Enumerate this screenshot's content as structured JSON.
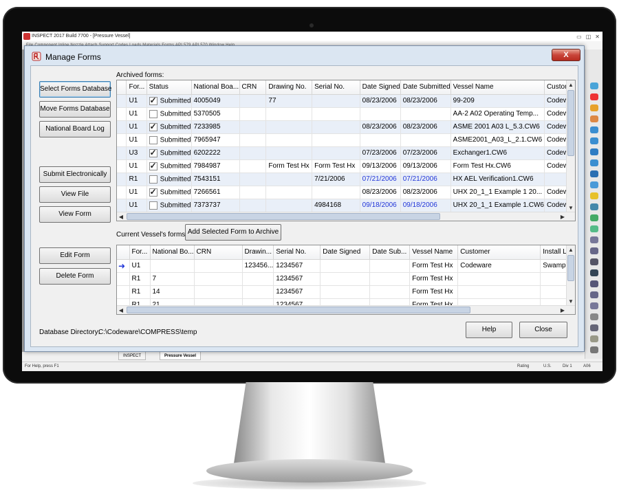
{
  "app": {
    "title": "INSPECT 2017 Build 7700 - [Pressure Vessel]",
    "menu": "File   Component   Inline   Nozzle   Attach   Support   Codes   Loads   Materials   Forms   API 579   API 570   Window   Help",
    "tabs": [
      "INSPECT",
      "Pressure Vessel"
    ],
    "status_left": "For Help, press F1",
    "status_cells": [
      "Rating",
      "U.S.",
      "Div 1",
      "A06"
    ]
  },
  "dialog": {
    "title": "Manage Forms",
    "close_label": "X",
    "archived_label": "Archived forms:",
    "current_label": "Current Vessel's forms:",
    "db_dir_label": "Database Directory:",
    "db_dir_value": "C:\\Codeware\\COMPRESS\\temp",
    "buttons": {
      "select_db": "Select Forms Database",
      "move_db": "Move Forms Database",
      "nb_log": "National Board Log",
      "submit": "Submit Electronically",
      "view_file": "View File",
      "view_form": "View Form",
      "edit_form": "Edit Form",
      "delete_form": "Delete Form",
      "add_to_archive": "Add Selected Form to Archive",
      "help": "Help",
      "close": "Close"
    }
  },
  "archived": {
    "columns": [
      "For...",
      "Status",
      "National Boa...",
      "CRN",
      "Drawing No.",
      "Serial No.",
      "Date Signed",
      "Date Submitted",
      "Vessel Name",
      "Custome"
    ],
    "rows": [
      {
        "form": "U1",
        "checked": true,
        "status": "Submitted",
        "nb": "4005049",
        "crn": "",
        "drawing": "77",
        "serial": "",
        "signed": "08/23/2006",
        "submitted": "08/23/2006",
        "vessel": "99-209",
        "customer": "Codewar",
        "blue": false
      },
      {
        "form": "U1",
        "checked": false,
        "status": "Submitted",
        "nb": "5370505",
        "crn": "",
        "drawing": "",
        "serial": "",
        "signed": "",
        "submitted": "",
        "vessel": "AA-2 A02 Operating Temp...",
        "customer": "Codewar",
        "blue": false
      },
      {
        "form": "U1",
        "checked": true,
        "status": "Submitted",
        "nb": "7233985",
        "crn": "",
        "drawing": "",
        "serial": "",
        "signed": "08/23/2006",
        "submitted": "08/23/2006",
        "vessel": "ASME 2001 A03 L_5.3.CW6",
        "customer": "Codewar",
        "blue": false
      },
      {
        "form": "U1",
        "checked": false,
        "status": "Submitted",
        "nb": "7965947",
        "crn": "",
        "drawing": "",
        "serial": "",
        "signed": "",
        "submitted": "",
        "vessel": "ASME2001_A03_L_2.1.CW6",
        "customer": "Codewar",
        "blue": false
      },
      {
        "form": "U3",
        "checked": true,
        "status": "Submitted",
        "nb": "6202222",
        "crn": "",
        "drawing": "",
        "serial": "",
        "signed": "07/23/2006",
        "submitted": "07/23/2006",
        "vessel": "Exchanger1.CW6",
        "customer": "Codewar",
        "blue": false
      },
      {
        "form": "U1",
        "checked": true,
        "status": "Submitted",
        "nb": "7984987",
        "crn": "",
        "drawing": "Form Test Hx",
        "serial": "Form Test Hx",
        "signed": "09/13/2006",
        "submitted": "09/13/2006",
        "vessel": "Form Test Hx.CW6",
        "customer": "Codewar",
        "blue": false
      },
      {
        "form": "R1",
        "checked": false,
        "status": "Submitted",
        "nb": "7543151",
        "crn": "",
        "drawing": "",
        "serial": "7/21/2006",
        "signed": "07/21/2006",
        "submitted": "07/21/2006",
        "vessel": "HX AEL Verification1.CW6",
        "customer": "",
        "blue": true
      },
      {
        "form": "U1",
        "checked": true,
        "status": "Submitted",
        "nb": "7266561",
        "crn": "",
        "drawing": "",
        "serial": "",
        "signed": "08/23/2006",
        "submitted": "08/23/2006",
        "vessel": "UHX 20_1_1 Example 1 20...",
        "customer": "Codewar",
        "blue": false
      },
      {
        "form": "U1",
        "checked": false,
        "status": "Submitted",
        "nb": "7373737",
        "crn": "",
        "drawing": "",
        "serial": "4984168",
        "signed": "09/18/2006",
        "submitted": "09/18/2006",
        "vessel": "UHX 20_1_1 Example 1.CW6",
        "customer": "Codewar",
        "blue": true
      }
    ]
  },
  "current": {
    "columns": [
      "For...",
      "National Bo...",
      "CRN",
      "Drawin...",
      "Serial No.",
      "Date Signed",
      "Date Sub...",
      "Vessel Name",
      "Customer",
      "Install Lo"
    ],
    "rows": [
      {
        "form": "U1",
        "nb": "",
        "crn": "",
        "drawing": "123456...",
        "serial": "1234567",
        "signed": "",
        "submitted": "",
        "vessel": "Form Test Hx",
        "customer": "Codeware",
        "install": "Swamp T",
        "current": true
      },
      {
        "form": "R1",
        "nb": "7",
        "crn": "",
        "drawing": "",
        "serial": "1234567",
        "signed": "",
        "submitted": "",
        "vessel": "Form Test Hx",
        "customer": "",
        "install": "",
        "current": false
      },
      {
        "form": "R1",
        "nb": "14",
        "crn": "",
        "drawing": "",
        "serial": "1234567",
        "signed": "",
        "submitted": "",
        "vessel": "Form Test Hx",
        "customer": "",
        "install": "",
        "current": false
      },
      {
        "form": "R1",
        "nb": "21",
        "crn": "",
        "drawing": "",
        "serial": "1234567",
        "signed": "",
        "submitted": "",
        "vessel": "Form Test Hx",
        "customer": "",
        "install": "",
        "current": false
      }
    ]
  },
  "colors": {
    "accent_blue": "#2035d8",
    "row_alt": "#e9eff8",
    "close_red": "#c9453a"
  }
}
